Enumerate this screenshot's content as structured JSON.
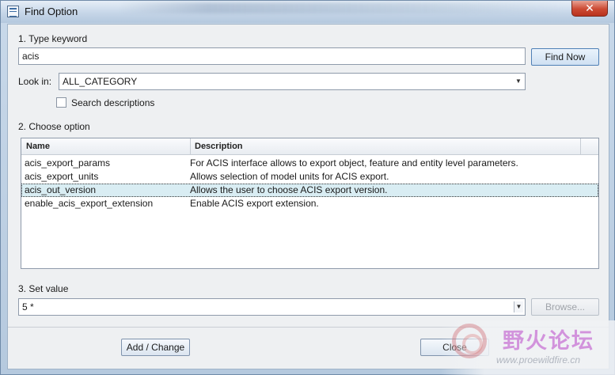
{
  "window": {
    "title": "Find Option",
    "close_glyph": "✕"
  },
  "step1": {
    "label": "1.  Type keyword",
    "keyword_value": "acis",
    "find_now_label": "Find Now",
    "look_in_label": "Look in:",
    "look_in_value": "ALL_CATEGORY",
    "search_descriptions_label": "Search descriptions",
    "search_descriptions_checked": false
  },
  "step2": {
    "label": "2.  Choose option",
    "columns": [
      "Name",
      "Description"
    ],
    "rows": [
      {
        "name": "acis_export_params",
        "description": "For ACIS interface allows to export object, feature and entity level parameters."
      },
      {
        "name": "acis_export_units",
        "description": "Allows selection of model units for ACIS export."
      },
      {
        "name": "acis_out_version",
        "description": "Allows the user to choose ACIS export version."
      },
      {
        "name": "enable_acis_export_extension",
        "description": "Enable ACIS export extension."
      }
    ],
    "selected_row_name": "acis_out_version"
  },
  "step3": {
    "label": "3.  Set value",
    "value": "5 *",
    "browse_label": "Browse..."
  },
  "footer": {
    "add_change_label": "Add / Change",
    "close_label": "Close"
  },
  "watermark": {
    "text_cn": "野火论坛",
    "url": "www.proewildfire.cn"
  },
  "icons": {
    "app": "window-app-icon",
    "dropdown": "chevron-down-icon"
  }
}
